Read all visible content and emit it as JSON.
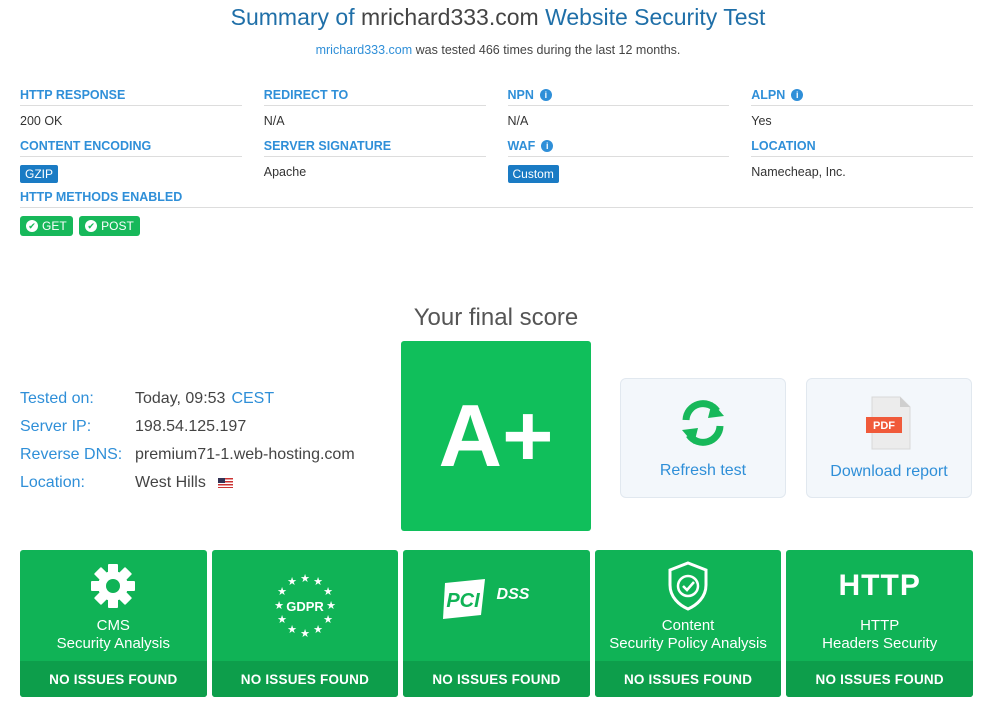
{
  "header": {
    "title_prefix": "Summary of",
    "title_domain": "mrichard333.com",
    "title_suffix": "Website Security Test",
    "subtitle_domain": "mrichard333.com",
    "subtitle_rest": "was tested 466 times during the last 12 months."
  },
  "info": {
    "http_response": {
      "label": "HTTP RESPONSE",
      "value": "200 OK"
    },
    "redirect_to": {
      "label": "REDIRECT TO",
      "value": "N/A"
    },
    "npn": {
      "label": "NPN",
      "value": "N/A"
    },
    "alpn": {
      "label": "ALPN",
      "value": "Yes"
    },
    "content_encoding": {
      "label": "CONTENT ENCODING",
      "value": "GZIP"
    },
    "server_signature": {
      "label": "SERVER SIGNATURE",
      "value": "Apache"
    },
    "waf": {
      "label": "WAF",
      "value": "Custom"
    },
    "location": {
      "label": "LOCATION",
      "value": "Namecheap, Inc."
    },
    "http_methods": {
      "label": "HTTP METHODS ENABLED",
      "values": [
        "GET",
        "POST"
      ]
    },
    "info_icon_glyph": "i"
  },
  "score": {
    "label": "Your final score",
    "grade": "A+",
    "color": "#10bf5b"
  },
  "details": {
    "tested_on": {
      "label": "Tested on:",
      "value": "Today, 09:53",
      "tz": "CEST"
    },
    "server_ip": {
      "label": "Server IP:",
      "value": "198.54.125.197"
    },
    "reverse_dns": {
      "label": "Reverse DNS:",
      "value": "premium71-1.web-hosting.com"
    },
    "location": {
      "label": "Location:",
      "value": "West Hills",
      "flag_icon": "us-flag-icon"
    }
  },
  "actions": {
    "refresh": {
      "label": "Refresh test",
      "icon": "refresh-icon"
    },
    "download": {
      "label": "Download report",
      "icon": "pdf-icon",
      "pdf_text": "PDF"
    }
  },
  "tiles": [
    {
      "title_line1": "CMS",
      "title_line2": "Security Analysis",
      "status": "NO ISSUES FOUND",
      "icon": "gear-icon"
    },
    {
      "title_line1": "",
      "title_line2": "",
      "status": "NO ISSUES FOUND",
      "icon": "gdpr-icon",
      "icon_text": "GDPR"
    },
    {
      "title_line1": "",
      "title_line2": "",
      "status": "NO ISSUES FOUND",
      "icon": "pci-dss-icon",
      "icon_text": "PCI",
      "icon_text2": "DSS"
    },
    {
      "title_line1": "Content",
      "title_line2": "Security Policy Analysis",
      "status": "NO ISSUES FOUND",
      "icon": "shield-check-icon"
    },
    {
      "title_line1": "HTTP",
      "title_line2": "Headers Security",
      "status": "NO ISSUES FOUND",
      "icon": "http-icon",
      "icon_text": "HTTP"
    }
  ],
  "colors": {
    "accent": "#2f8fd8",
    "title_blue": "#1f6fa8",
    "success": "#10b356",
    "success_dark": "#0d9e4b",
    "tag_blue": "#1a7bc4"
  }
}
